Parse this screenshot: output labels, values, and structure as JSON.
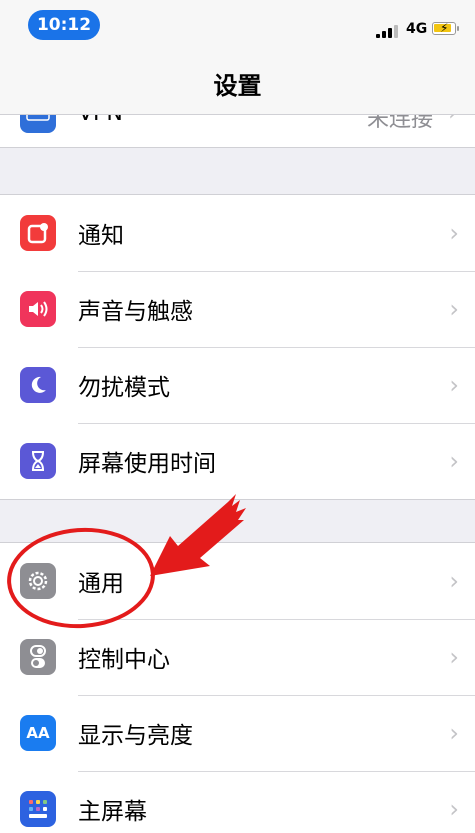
{
  "status_bar": {
    "time": "10:12",
    "network": "4G"
  },
  "nav": {
    "title": "设置"
  },
  "vpn_row": {
    "label": "VPN",
    "value": "未连接",
    "icon": "vpn-icon"
  },
  "group1": [
    {
      "label": "通知",
      "icon": "notifications-icon",
      "color": "#f23b3b"
    },
    {
      "label": "声音与触感",
      "icon": "sound-icon",
      "color": "#f0345b"
    },
    {
      "label": "勿扰模式",
      "icon": "moon-icon",
      "color": "#5b58d6"
    },
    {
      "label": "屏幕使用时间",
      "icon": "hourglass-icon",
      "color": "#5b58d6"
    }
  ],
  "group2": [
    {
      "label": "通用",
      "icon": "gear-icon",
      "color": "#8e8e93"
    },
    {
      "label": "控制中心",
      "icon": "toggle-icon",
      "color": "#8e8e93"
    },
    {
      "label": "显示与亮度",
      "icon": "display-icon",
      "color": "#1a7cf0"
    },
    {
      "label": "主屏幕",
      "icon": "home-screen-icon",
      "color": "#2d62e0"
    }
  ],
  "display_icon_text": "AA",
  "chevron": "›",
  "annotation_color": "#e31b1b"
}
